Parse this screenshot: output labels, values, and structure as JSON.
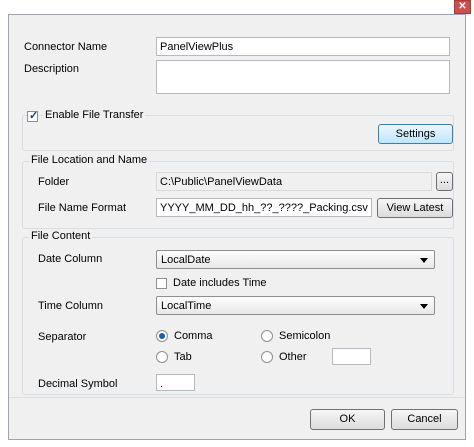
{
  "titlebar": {
    "close_glyph": "✕"
  },
  "connector": {
    "name_label": "Connector Name",
    "name_value": "PanelViewPlus",
    "description_label": "Description",
    "description_value": ""
  },
  "transfer": {
    "enable_label": "Enable File Transfer",
    "enabled": true,
    "settings_label": "Settings"
  },
  "location": {
    "group_title": "File Location and Name",
    "folder_label": "Folder",
    "folder_value": "C:\\Public\\PanelViewData",
    "browse_label": "...",
    "format_label": "File Name Format",
    "format_value": "YYYY_MM_DD_hh_??_????_Packing.csv",
    "view_latest_label": "View Latest"
  },
  "content": {
    "group_title": "File Content",
    "date_column_label": "Date Column",
    "date_column_value": "LocalDate",
    "date_includes_time_label": "Date includes Time",
    "time_column_label": "Time Column",
    "time_column_value": "LocalTime",
    "separator_label": "Separator",
    "sep_comma": "Comma",
    "sep_semicolon": "Semicolon",
    "sep_tab": "Tab",
    "sep_other": "Other",
    "sep_other_value": "",
    "decimal_label": "Decimal Symbol",
    "decimal_value": "."
  },
  "footer": {
    "ok_label": "OK",
    "cancel_label": "Cancel"
  }
}
